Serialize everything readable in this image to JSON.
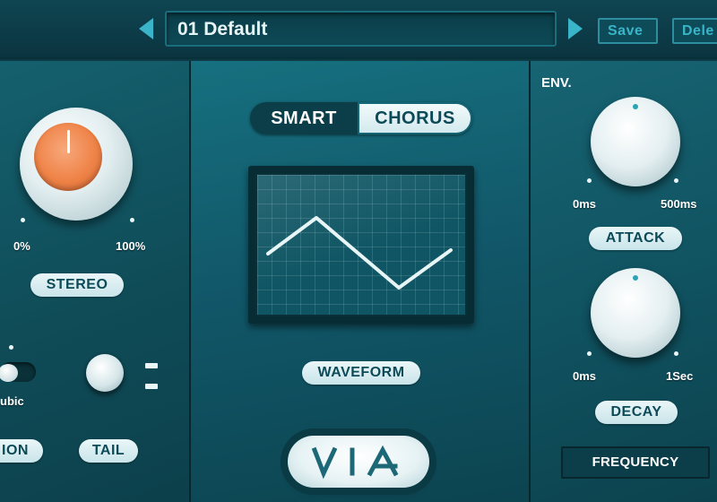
{
  "preset": {
    "name": "01 Default",
    "save_label": "Save",
    "delete_label": "Dele"
  },
  "left_panel": {
    "stereo": {
      "min_label": "0%",
      "max_label": "100%",
      "label": "STEREO"
    },
    "interpolation": {
      "option_label": "ubic",
      "label": "ION"
    },
    "tail": {
      "label": "TAIL"
    }
  },
  "center_panel": {
    "mode_smart": "SMART",
    "mode_chorus": "CHORUS",
    "waveform_label": "WAVEFORM",
    "logo_text": "VIA"
  },
  "right_panel": {
    "env_label": "ENV.",
    "attack": {
      "min_label": "0ms",
      "max_label": "500ms",
      "label": "ATTACK"
    },
    "decay": {
      "min_label": "0ms",
      "max_label": "1Sec",
      "label": "DECAY"
    },
    "frequency_label": "FREQUENCY"
  },
  "colors": {
    "accent": "#3ab4c8",
    "panel_dark": "#0b3e49",
    "knob_orange": "#ef8347",
    "pill_bg": "#eaf6f8"
  },
  "icons": {
    "prev": "triangle-left-icon",
    "next": "triangle-right-icon",
    "tail_mode": "bars-icon"
  }
}
